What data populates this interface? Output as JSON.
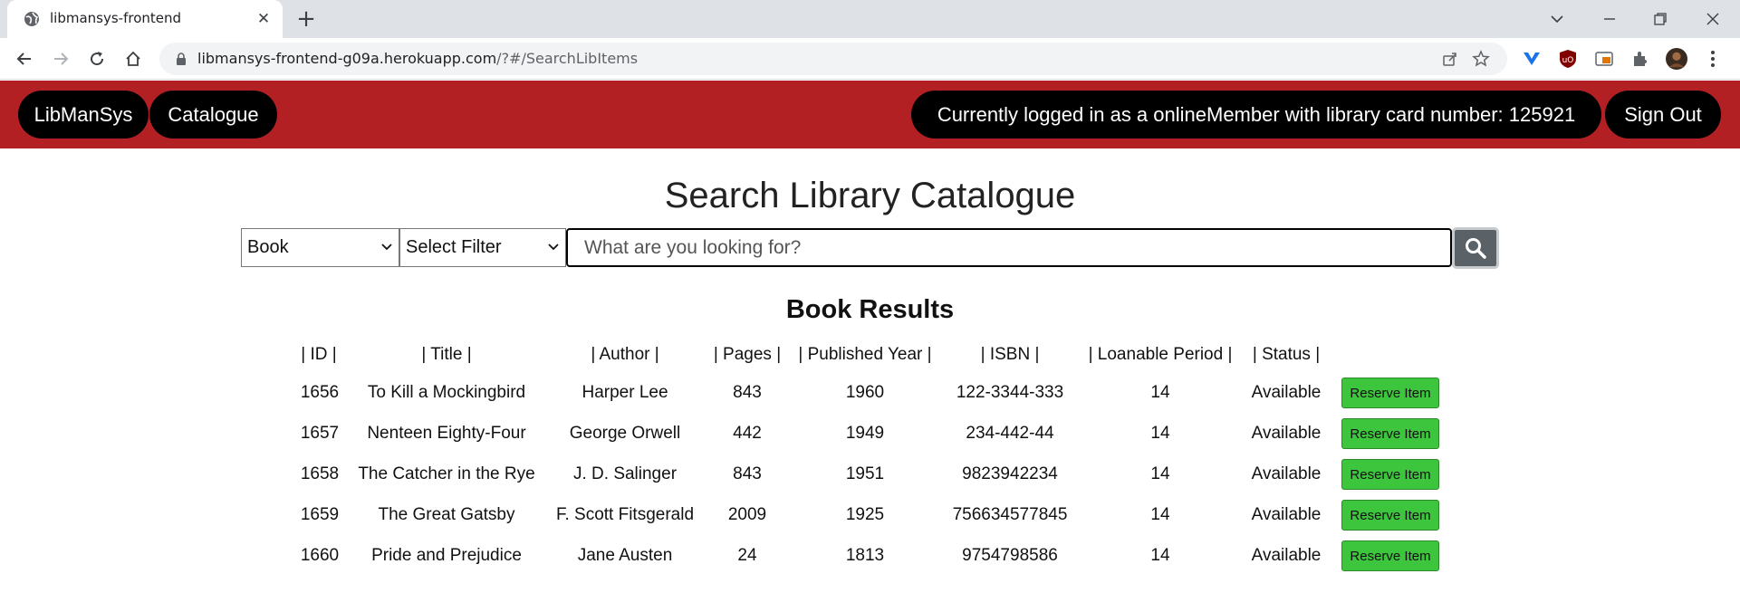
{
  "browser": {
    "tab_title": "libmansys-frontend",
    "url_host": "libmansys-frontend-g09a.herokuapp.com",
    "url_path": "/?#/SearchLibItems"
  },
  "header": {
    "brand_label": "LibManSys",
    "catalogue_label": "Catalogue",
    "login_status": "Currently logged in as a onlineMember with library card number: 125921",
    "signout_label": "Sign Out",
    "color": "#b32024"
  },
  "search": {
    "title": "Search Library Catalogue",
    "type_selected": "Book",
    "filter_selected": "Select Filter",
    "placeholder": "What are you looking for?"
  },
  "results": {
    "title": "Book Results",
    "columns": [
      "| ID |",
      "| Title |",
      "| Author |",
      "| Pages |",
      "| Published Year |",
      "| ISBN |",
      "| Loanable Period |",
      "| Status |"
    ],
    "rows": [
      [
        "1656",
        "To Kill a Mockingbird",
        "Harper Lee",
        "843",
        "1960",
        "122-3344-333",
        "14",
        "Available"
      ],
      [
        "1657",
        "Nenteen Eighty-Four",
        "George Orwell",
        "442",
        "1949",
        "234-442-44",
        "14",
        "Available"
      ],
      [
        "1658",
        "The Catcher in the Rye",
        "J. D. Salinger",
        "843",
        "1951",
        "9823942234",
        "14",
        "Available"
      ],
      [
        "1659",
        "The Great Gatsby",
        "F. Scott Fitsgerald",
        "2009",
        "1925",
        "756634577845",
        "14",
        "Available"
      ],
      [
        "1660",
        "Pride and Prejudice",
        "Jane Austen",
        "24",
        "1813",
        "9754798586",
        "14",
        "Available"
      ]
    ],
    "reserve_label": "Reserve Item"
  }
}
